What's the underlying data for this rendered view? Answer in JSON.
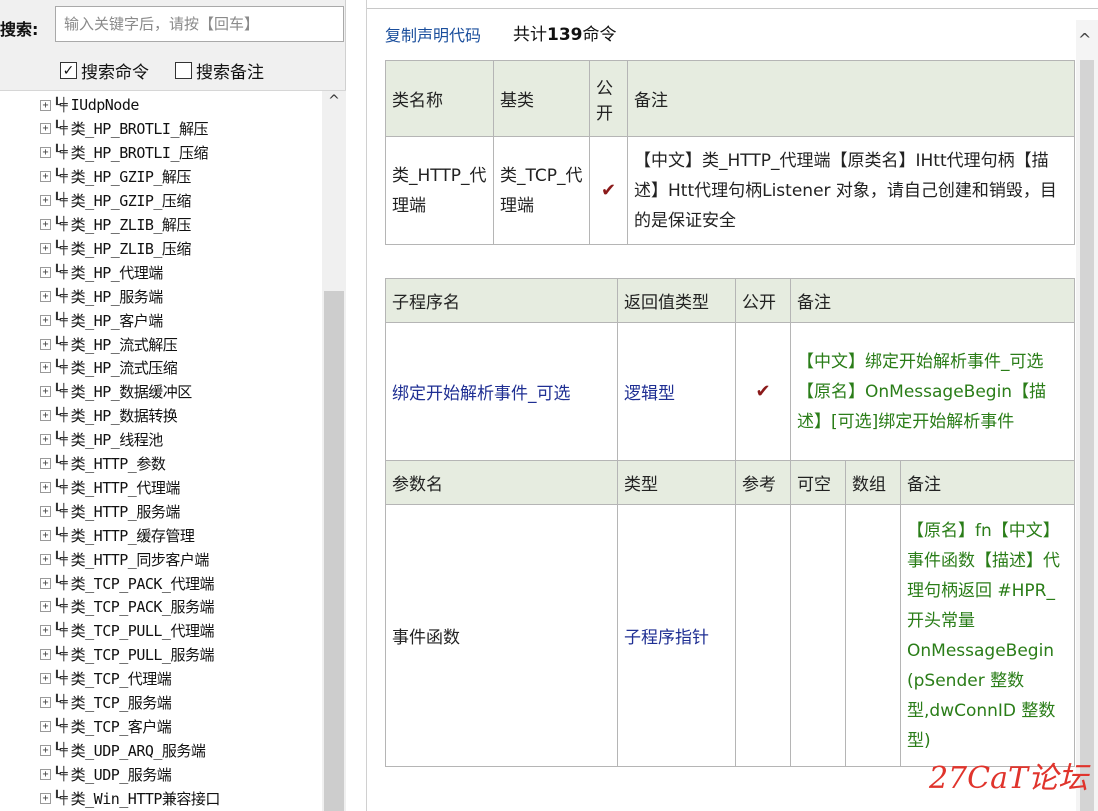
{
  "left_pane": {
    "search_label": "搜索:",
    "search_placeholder": "输入关键字后，请按【回车】",
    "checkbox_cmd": {
      "label": "搜索命令",
      "checked": true
    },
    "checkbox_note": {
      "label": "搜索备注",
      "checked": false
    },
    "tree_items": [
      "IUdpNode",
      "类_HP_BROTLI_解压",
      "类_HP_BROTLI_压缩",
      "类_HP_GZIP_解压",
      "类_HP_GZIP_压缩",
      "类_HP_ZLIB_解压",
      "类_HP_ZLIB_压缩",
      "类_HP_代理端",
      "类_HP_服务端",
      "类_HP_客户端",
      "类_HP_流式解压",
      "类_HP_流式压缩",
      "类_HP_数据缓冲区",
      "类_HP_数据转换",
      "类_HP_线程池",
      "类_HTTP_参数",
      "类_HTTP_代理端",
      "类_HTTP_服务端",
      "类_HTTP_缓存管理",
      "类_HTTP_同步客户端",
      "类_TCP_PACK_代理端",
      "类_TCP_PACK_服务端",
      "类_TCP_PULL_代理端",
      "类_TCP_PULL_服务端",
      "类_TCP_代理端",
      "类_TCP_服务端",
      "类_TCP_客户端",
      "类_UDP_ARQ_服务端",
      "类_UDP_服务端",
      "类_Win_HTTP兼容接口"
    ]
  },
  "right_pane": {
    "copy_link": "复制声明代码",
    "total_prefix": "共计",
    "total_count": "139",
    "total_suffix": "命令",
    "class_table": {
      "headers": [
        "类名称",
        "基类",
        "公开",
        "备注"
      ],
      "row": {
        "name": "类_HTTP_代理端",
        "base": "类_TCP_代理端",
        "public": "✔",
        "note": "【中文】类_HTTP_代理端【原类名】IHtt代理句柄【描述】Htt代理句柄Listener 对象，请自己创建和销毁，目的是保证安全"
      }
    },
    "sub_table": {
      "headers": [
        "子程序名",
        "返回值类型",
        "公开",
        "备注"
      ],
      "row": {
        "name": "绑定开始解析事件_可选",
        "return_type": "逻辑型",
        "public": "✔",
        "note": "【中文】绑定开始解析事件_可选【原名】OnMessageBegin【描述】[可选]绑定开始解析事件"
      },
      "param_headers": [
        "参数名",
        "类型",
        "参考",
        "可空",
        "数组",
        "备注"
      ],
      "param_row": {
        "name": "事件函数",
        "type": "子程序指针",
        "ref": "",
        "nullable": "",
        "array": "",
        "note": "【原名】fn【中文】事件函数【描述】代理句柄返回 #HPR_ 开头常量 OnMessageBegin (pSender 整数型,dwConnID 整数型)"
      }
    }
  },
  "watermark": "27CaT论坛",
  "colors": {
    "header_bg": "#e6ece0",
    "link_blue": "#1a4e9c",
    "type_blue": "#1f2f93",
    "note_green": "#2a7d18",
    "check_red": "#8b1a1a",
    "watermark_red": "#e0342c"
  }
}
